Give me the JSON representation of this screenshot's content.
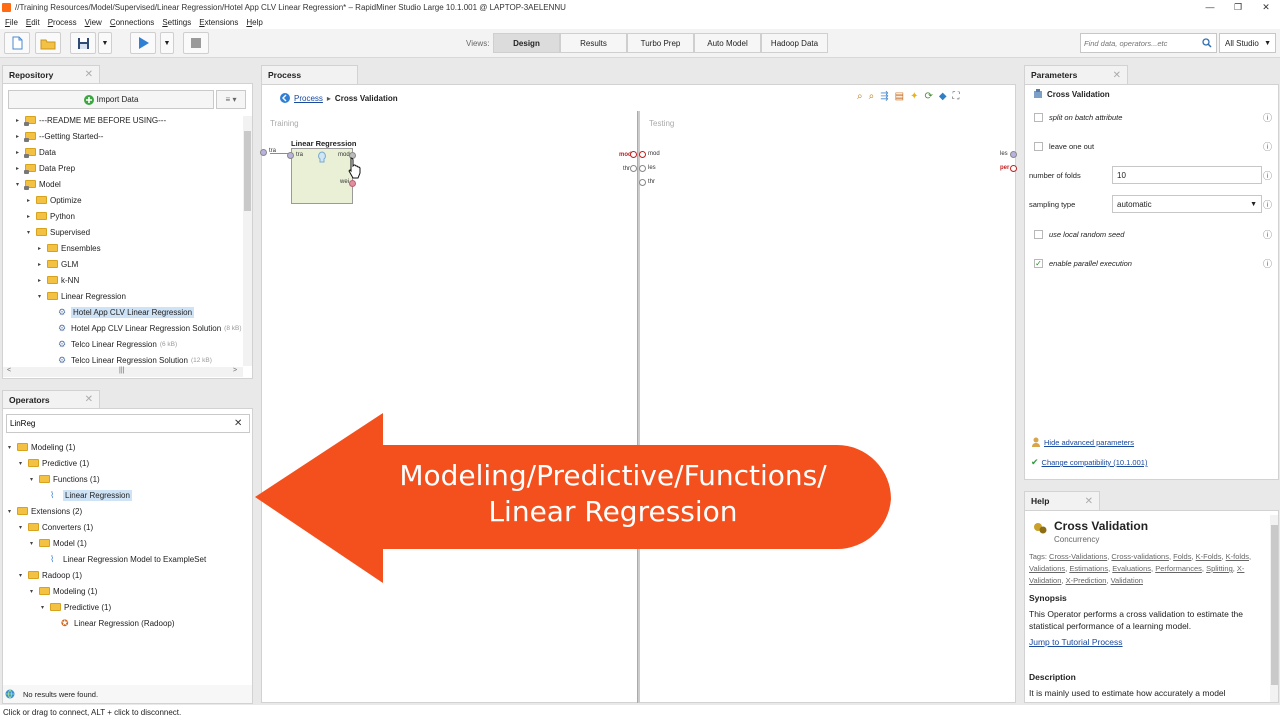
{
  "window": {
    "title": "//Training Resources/Model/Supervised/Linear Regression/Hotel App CLV Linear Regression* – RapidMiner Studio Large 10.1.001 @ LAPTOP-3AELENNU",
    "controls": [
      "—",
      "❐",
      "✕"
    ]
  },
  "menu": [
    "File",
    "Edit",
    "Process",
    "View",
    "Connections",
    "Settings",
    "Extensions",
    "Help"
  ],
  "toolbar": {
    "views_label": "Views:",
    "views": [
      "Design",
      "Results",
      "Turbo Prep",
      "Auto Model",
      "Hadoop Data"
    ],
    "active_view": "Design",
    "search_placeholder": "Find data, operators...etc",
    "studio_select": "All Studio"
  },
  "repository": {
    "tab": "Repository",
    "import_label": "Import Data",
    "items": [
      {
        "label": "---README ME BEFORE USING---",
        "level": 0,
        "expand": "▸",
        "type": "folder"
      },
      {
        "label": "--Getting Started--",
        "level": 0,
        "expand": "▸",
        "type": "folder"
      },
      {
        "label": "Data",
        "level": 0,
        "expand": "▸",
        "type": "folder"
      },
      {
        "label": "Data Prep",
        "level": 0,
        "expand": "▸",
        "type": "folder"
      },
      {
        "label": "Model",
        "level": 0,
        "expand": "▾",
        "type": "folder"
      },
      {
        "label": "Optimize",
        "level": 1,
        "expand": "▸",
        "type": "folder"
      },
      {
        "label": "Python",
        "level": 1,
        "expand": "▸",
        "type": "folder"
      },
      {
        "label": "Supervised",
        "level": 1,
        "expand": "▾",
        "type": "folder"
      },
      {
        "label": "Ensembles",
        "level": 2,
        "expand": "▸",
        "type": "folder"
      },
      {
        "label": "GLM",
        "level": 2,
        "expand": "▸",
        "type": "folder"
      },
      {
        "label": "k-NN",
        "level": 2,
        "expand": "▸",
        "type": "folder"
      },
      {
        "label": "Linear Regression",
        "level": 2,
        "expand": "▾",
        "type": "folder"
      },
      {
        "label": "Hotel App CLV Linear Regression",
        "level": 3,
        "expand": "",
        "type": "process",
        "selected": true,
        "size": ""
      },
      {
        "label": "Hotel App CLV Linear Regression Solution",
        "level": 3,
        "expand": "",
        "type": "process",
        "size": "(8 kB)"
      },
      {
        "label": "Telco Linear Regression",
        "level": 3,
        "expand": "",
        "type": "process",
        "size": "(6 kB)"
      },
      {
        "label": "Telco Linear Regression Solution",
        "level": 3,
        "expand": "",
        "type": "process",
        "size": "(12 kB)"
      }
    ]
  },
  "operators": {
    "tab": "Operators",
    "search_value": "LinReg",
    "items": [
      {
        "label": "Modeling (1)",
        "level": 0,
        "expand": "▾",
        "type": "folder"
      },
      {
        "label": "Predictive (1)",
        "level": 1,
        "expand": "▾",
        "type": "folder"
      },
      {
        "label": "Functions (1)",
        "level": 2,
        "expand": "▾",
        "type": "folder"
      },
      {
        "label": "Linear Regression",
        "level": 3,
        "expand": "",
        "type": "operator",
        "selected": true
      },
      {
        "label": "Extensions (2)",
        "level": 0,
        "expand": "▾",
        "type": "folder"
      },
      {
        "label": "Converters (1)",
        "level": 1,
        "expand": "▾",
        "type": "folder"
      },
      {
        "label": "Model (1)",
        "level": 2,
        "expand": "▾",
        "type": "folder"
      },
      {
        "label": "Linear Regression Model to ExampleSet",
        "level": 3,
        "expand": "",
        "type": "operator"
      },
      {
        "label": "Radoop (1)",
        "level": 1,
        "expand": "▾",
        "type": "folder"
      },
      {
        "label": "Modeling (1)",
        "level": 2,
        "expand": "▾",
        "type": "folder"
      },
      {
        "label": "Predictive (1)",
        "level": 3,
        "expand": "▾",
        "type": "folder"
      },
      {
        "label": "Linear Regression (Radoop)",
        "level": 4,
        "expand": "",
        "type": "radoop"
      }
    ],
    "status": "No results were found."
  },
  "process": {
    "tab": "Process",
    "breadcrumb_link": "Process",
    "breadcrumb_current": "Cross Validation",
    "training_label": "Training",
    "testing_label": "Testing",
    "operator_name": "Linear Regression",
    "ports": {
      "tra": "tra",
      "mod": "mod",
      "wei": "wei",
      "les": "les",
      "thr": "thr",
      "per": "per"
    }
  },
  "overlay": {
    "line1": "Modeling/Predictive/Functions/",
    "line2": "Linear Regression",
    "color": "#f4501e"
  },
  "parameters": {
    "tab": "Parameters",
    "operator": "Cross Validation",
    "split_on_batch": "split on batch attribute",
    "leave_one_out": "leave one out",
    "number_of_folds_label": "number of folds",
    "number_of_folds_value": "10",
    "sampling_type_label": "sampling type",
    "sampling_type_value": "automatic",
    "use_local_random_seed": "use local random seed",
    "enable_parallel": "enable parallel execution",
    "hide_advanced": "Hide advanced parameters",
    "change_compat": "Change compatibility (10.1.001)"
  },
  "help": {
    "tab": "Help",
    "title": "Cross Validation",
    "subtitle": "Concurrency",
    "tags_prefix": "Tags:",
    "tags": [
      "Cross-Validations",
      "Cross-validations",
      "Folds",
      "K-Folds",
      "K-folds",
      "Validations",
      "Estimations",
      "Evaluations",
      "Performances",
      "Splitting",
      "X-Validation",
      "X-Prediction",
      "Validation"
    ],
    "synopsis_heading": "Synopsis",
    "synopsis": "This Operator performs a cross validation to estimate the statistical performance of a learning model.",
    "jump_link": "Jump to Tutorial Process",
    "description_heading": "Description",
    "description": "It is mainly used to estimate how accurately a model"
  },
  "statusbar": "Click or drag to connect, ALT + click to disconnect."
}
